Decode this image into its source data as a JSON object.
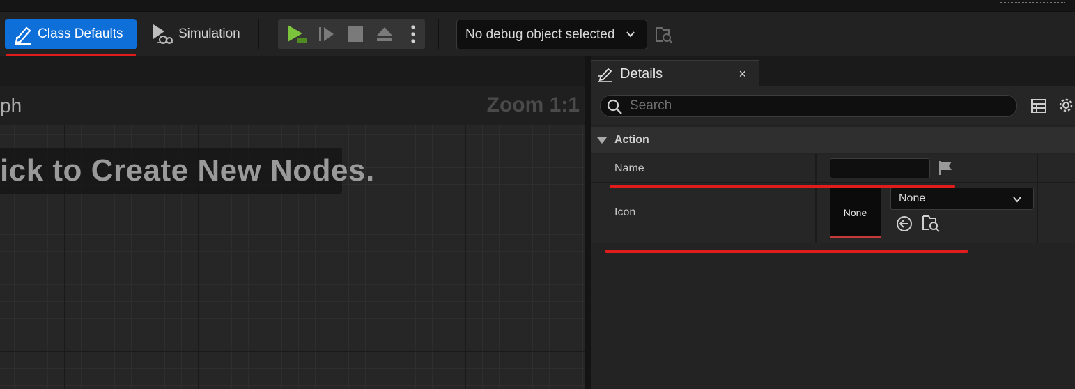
{
  "toolbar": {
    "class_defaults_label": "Class Defaults",
    "simulation_label": "Simulation",
    "debug_object_label": "No debug object selected"
  },
  "graph": {
    "title_partial": "ph",
    "zoom_label": "Zoom 1:1",
    "hint_partial": "ick to Create New Nodes."
  },
  "details": {
    "tab_label": "Details",
    "close_glyph": "×",
    "search_placeholder": "Search",
    "category_label": "Action",
    "properties": {
      "name_label": "Name",
      "name_value": "",
      "icon_label": "Icon",
      "icon_thumbnail_text": "None",
      "icon_dropdown_value": "None"
    }
  },
  "colors": {
    "accent_blue": "#0e6fd9",
    "annotation_red": "#e01c1c",
    "play_green": "#7cc43c"
  }
}
